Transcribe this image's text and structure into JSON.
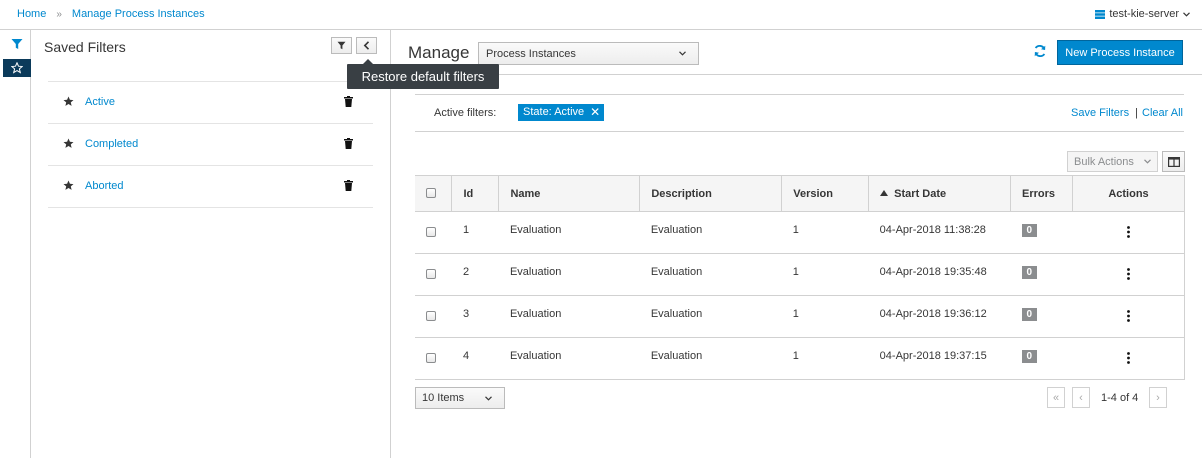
{
  "breadcrumb": {
    "home": "Home",
    "separator": "»",
    "current": "Manage Process Instances"
  },
  "server": {
    "label": "test-kie-server",
    "icon": "server-icon"
  },
  "rail": {
    "icons": [
      "filter-icon",
      "star-icon"
    ]
  },
  "saved_filters": {
    "title": "Saved Filters",
    "items": [
      {
        "label": "Active"
      },
      {
        "label": "Completed"
      },
      {
        "label": "Aborted"
      }
    ]
  },
  "tooltip": "Restore default filters",
  "main": {
    "manage_label": "Manage",
    "view_select": "Process Instances",
    "new_button": "New Process Instance",
    "active_filters_label": "Active filters:",
    "active_filter_chip": "State: Active",
    "save_filters": "Save Filters",
    "separator": "|",
    "clear_all": "Clear All",
    "bulk_actions": "Bulk Actions"
  },
  "table": {
    "columns": [
      "Id",
      "Name",
      "Description",
      "Version",
      "Start Date",
      "Errors",
      "Actions"
    ],
    "rows": [
      {
        "id": "1",
        "name": "Evaluation",
        "description": "Evaluation",
        "version": "1",
        "start_date": "04-Apr-2018 11:38:28",
        "errors": "0"
      },
      {
        "id": "2",
        "name": "Evaluation",
        "description": "Evaluation",
        "version": "1",
        "start_date": "04-Apr-2018 19:35:48",
        "errors": "0"
      },
      {
        "id": "3",
        "name": "Evaluation",
        "description": "Evaluation",
        "version": "1",
        "start_date": "04-Apr-2018 19:36:12",
        "errors": "0"
      },
      {
        "id": "4",
        "name": "Evaluation",
        "description": "Evaluation",
        "version": "1",
        "start_date": "04-Apr-2018 19:37:15",
        "errors": "0"
      }
    ]
  },
  "pagination": {
    "page_size": "10 Items",
    "first": "«",
    "prev": "‹",
    "range": "1-4 of 4",
    "next": "›"
  },
  "colors": {
    "accent": "#0088ce",
    "tab_dark": "#0b3a5a",
    "tooltip_bg": "#393f44",
    "badge_gray": "#8b8d8f"
  }
}
